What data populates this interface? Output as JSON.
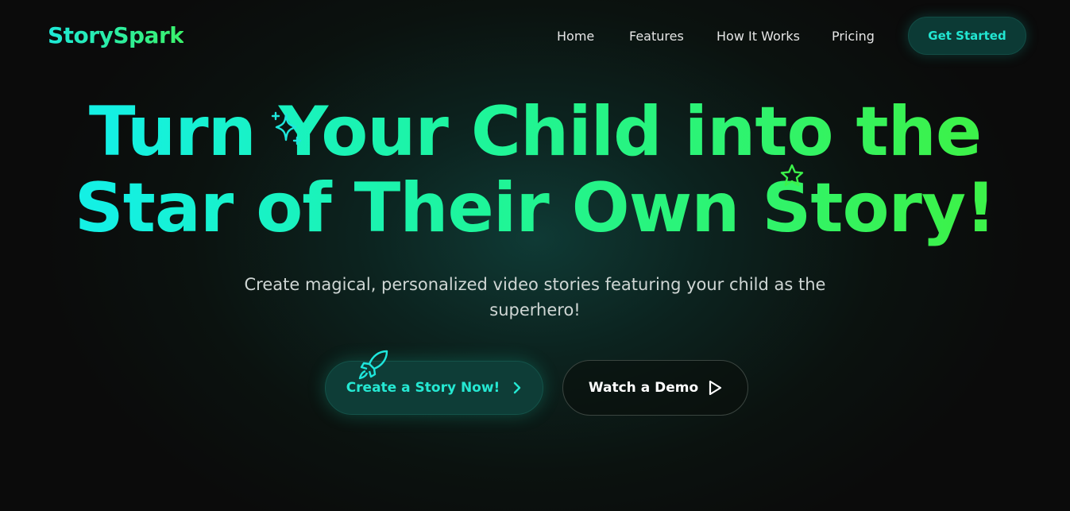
{
  "nav": {
    "logo": "StorySpark",
    "links": [
      "Home",
      "Features",
      "How It Works",
      "Pricing"
    ],
    "cta": "Get Started"
  },
  "hero": {
    "title_line1": "Turn Your Child into the",
    "title_line2": "Star of Their Own Story!",
    "subtitle_line1": "Create magical, personalized video stories featuring your child as the",
    "subtitle_line2": "superhero!",
    "primary_button": "Create a Story Now!",
    "secondary_button": "Watch a Demo"
  },
  "icons": [
    "sparkles-icon",
    "star-icon",
    "rocket-icon",
    "chevron-right-icon",
    "play-icon"
  ],
  "colors": {
    "accent_cyan": "#22e6d2",
    "accent_green": "#3cf24a",
    "background": "#0b0b0b"
  }
}
